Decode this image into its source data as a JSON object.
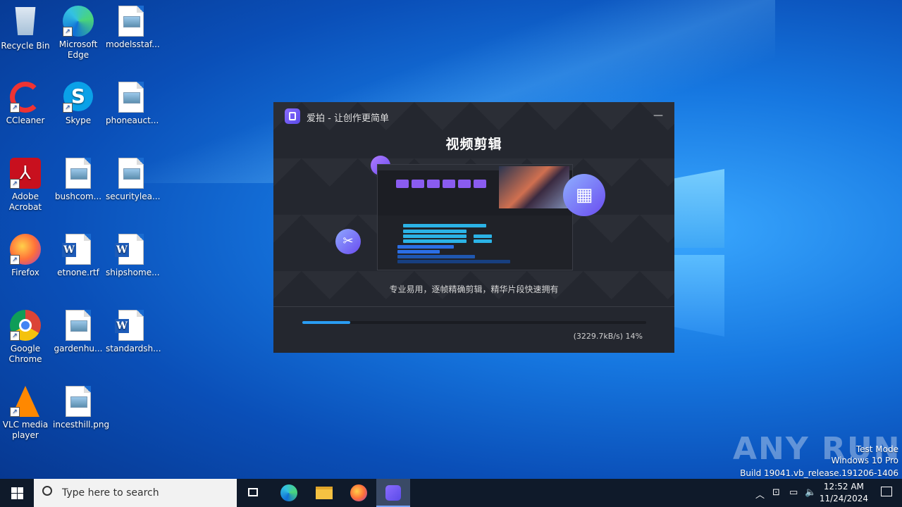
{
  "desktop": {
    "icons": [
      {
        "label": "Recycle Bin",
        "type": "recycle-bin-icon"
      },
      {
        "label": "Microsoft Edge",
        "type": "edge-icon"
      },
      {
        "label": "modelsstaf...",
        "type": "image-file-icon"
      },
      {
        "label": "CCleaner",
        "type": "ccleaner-icon"
      },
      {
        "label": "Skype",
        "type": "skype-icon"
      },
      {
        "label": "phoneauct...",
        "type": "image-file-icon"
      },
      {
        "label": "Adobe Acrobat",
        "type": "acrobat-icon"
      },
      {
        "label": "bushcom...",
        "type": "image-file-icon"
      },
      {
        "label": "securitylea...",
        "type": "image-file-icon"
      },
      {
        "label": "Firefox",
        "type": "firefox-icon"
      },
      {
        "label": "etnone.rtf",
        "type": "word-doc-icon"
      },
      {
        "label": "shipshome...",
        "type": "word-doc-icon"
      },
      {
        "label": "Google Chrome",
        "type": "chrome-icon"
      },
      {
        "label": "gardenhu...",
        "type": "image-file-icon"
      },
      {
        "label": "standardsh...",
        "type": "word-doc-icon"
      },
      {
        "label": "VLC media player",
        "type": "vlc-icon"
      },
      {
        "label": "incesthill.png",
        "type": "image-file-icon"
      }
    ]
  },
  "installer": {
    "title": "爱拍 - 让创作更简单",
    "minimize": "—",
    "headline": "视频剪辑",
    "subtitle": "专业易用，逐帧精确剪辑，精华片段快速拥有",
    "progress_fraction": 0.14,
    "speed_text": "(3229.7kB/s) 14%",
    "accent_color": "#2a9df4"
  },
  "watermark": {
    "text": "ANY RUN",
    "line1": "Test Mode",
    "line2": "Windows 10 Pro",
    "line3": "Build 19041.vb_release.191206-1406"
  },
  "taskbar": {
    "search_placeholder": "Type here to search",
    "time": "12:52 AM",
    "date": "11/24/2024"
  }
}
